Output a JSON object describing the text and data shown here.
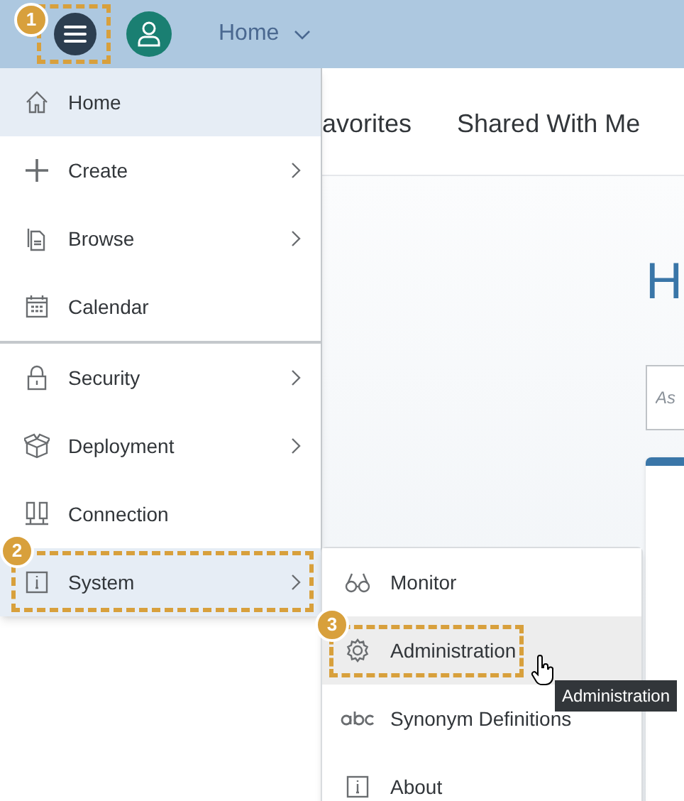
{
  "header": {
    "nav_title": "Home"
  },
  "tabs": [
    {
      "label": "avorites"
    },
    {
      "label": "Shared With Me"
    }
  ],
  "page": {
    "heading": "H",
    "search": {
      "placeholder": "As"
    }
  },
  "menu": [
    {
      "label": "Home",
      "selected": true,
      "has_submenu": false,
      "divider_after": false
    },
    {
      "label": "Create",
      "selected": false,
      "has_submenu": true,
      "divider_after": false
    },
    {
      "label": "Browse",
      "selected": false,
      "has_submenu": true,
      "divider_after": false
    },
    {
      "label": "Calendar",
      "selected": false,
      "has_submenu": false,
      "divider_after": true
    },
    {
      "label": "Security",
      "selected": false,
      "has_submenu": true,
      "divider_after": false
    },
    {
      "label": "Deployment",
      "selected": false,
      "has_submenu": true,
      "divider_after": false
    },
    {
      "label": "Connection",
      "selected": false,
      "has_submenu": false,
      "divider_after": false
    },
    {
      "label": "System",
      "selected": true,
      "has_submenu": true,
      "divider_after": false
    }
  ],
  "submenu": [
    {
      "label": "Monitor",
      "selected": false
    },
    {
      "label": "Administration",
      "selected": true
    },
    {
      "label": "Synonym Definitions",
      "selected": false
    },
    {
      "label": "About",
      "selected": false
    }
  ],
  "tooltip": "Administration",
  "callouts": [
    "1",
    "2",
    "3"
  ]
}
